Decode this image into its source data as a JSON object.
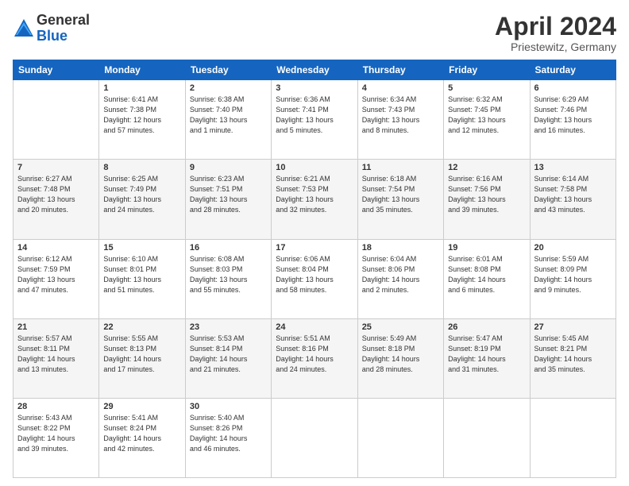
{
  "logo": {
    "general": "General",
    "blue": "Blue"
  },
  "title": "April 2024",
  "subtitle": "Priestewitz, Germany",
  "days_of_week": [
    "Sunday",
    "Monday",
    "Tuesday",
    "Wednesday",
    "Thursday",
    "Friday",
    "Saturday"
  ],
  "weeks": [
    [
      {
        "day": "",
        "info": ""
      },
      {
        "day": "1",
        "info": "Sunrise: 6:41 AM\nSunset: 7:38 PM\nDaylight: 12 hours\nand 57 minutes."
      },
      {
        "day": "2",
        "info": "Sunrise: 6:38 AM\nSunset: 7:40 PM\nDaylight: 13 hours\nand 1 minute."
      },
      {
        "day": "3",
        "info": "Sunrise: 6:36 AM\nSunset: 7:41 PM\nDaylight: 13 hours\nand 5 minutes."
      },
      {
        "day": "4",
        "info": "Sunrise: 6:34 AM\nSunset: 7:43 PM\nDaylight: 13 hours\nand 8 minutes."
      },
      {
        "day": "5",
        "info": "Sunrise: 6:32 AM\nSunset: 7:45 PM\nDaylight: 13 hours\nand 12 minutes."
      },
      {
        "day": "6",
        "info": "Sunrise: 6:29 AM\nSunset: 7:46 PM\nDaylight: 13 hours\nand 16 minutes."
      }
    ],
    [
      {
        "day": "7",
        "info": "Sunrise: 6:27 AM\nSunset: 7:48 PM\nDaylight: 13 hours\nand 20 minutes."
      },
      {
        "day": "8",
        "info": "Sunrise: 6:25 AM\nSunset: 7:49 PM\nDaylight: 13 hours\nand 24 minutes."
      },
      {
        "day": "9",
        "info": "Sunrise: 6:23 AM\nSunset: 7:51 PM\nDaylight: 13 hours\nand 28 minutes."
      },
      {
        "day": "10",
        "info": "Sunrise: 6:21 AM\nSunset: 7:53 PM\nDaylight: 13 hours\nand 32 minutes."
      },
      {
        "day": "11",
        "info": "Sunrise: 6:18 AM\nSunset: 7:54 PM\nDaylight: 13 hours\nand 35 minutes."
      },
      {
        "day": "12",
        "info": "Sunrise: 6:16 AM\nSunset: 7:56 PM\nDaylight: 13 hours\nand 39 minutes."
      },
      {
        "day": "13",
        "info": "Sunrise: 6:14 AM\nSunset: 7:58 PM\nDaylight: 13 hours\nand 43 minutes."
      }
    ],
    [
      {
        "day": "14",
        "info": "Sunrise: 6:12 AM\nSunset: 7:59 PM\nDaylight: 13 hours\nand 47 minutes."
      },
      {
        "day": "15",
        "info": "Sunrise: 6:10 AM\nSunset: 8:01 PM\nDaylight: 13 hours\nand 51 minutes."
      },
      {
        "day": "16",
        "info": "Sunrise: 6:08 AM\nSunset: 8:03 PM\nDaylight: 13 hours\nand 55 minutes."
      },
      {
        "day": "17",
        "info": "Sunrise: 6:06 AM\nSunset: 8:04 PM\nDaylight: 13 hours\nand 58 minutes."
      },
      {
        "day": "18",
        "info": "Sunrise: 6:04 AM\nSunset: 8:06 PM\nDaylight: 14 hours\nand 2 minutes."
      },
      {
        "day": "19",
        "info": "Sunrise: 6:01 AM\nSunset: 8:08 PM\nDaylight: 14 hours\nand 6 minutes."
      },
      {
        "day": "20",
        "info": "Sunrise: 5:59 AM\nSunset: 8:09 PM\nDaylight: 14 hours\nand 9 minutes."
      }
    ],
    [
      {
        "day": "21",
        "info": "Sunrise: 5:57 AM\nSunset: 8:11 PM\nDaylight: 14 hours\nand 13 minutes."
      },
      {
        "day": "22",
        "info": "Sunrise: 5:55 AM\nSunset: 8:13 PM\nDaylight: 14 hours\nand 17 minutes."
      },
      {
        "day": "23",
        "info": "Sunrise: 5:53 AM\nSunset: 8:14 PM\nDaylight: 14 hours\nand 21 minutes."
      },
      {
        "day": "24",
        "info": "Sunrise: 5:51 AM\nSunset: 8:16 PM\nDaylight: 14 hours\nand 24 minutes."
      },
      {
        "day": "25",
        "info": "Sunrise: 5:49 AM\nSunset: 8:18 PM\nDaylight: 14 hours\nand 28 minutes."
      },
      {
        "day": "26",
        "info": "Sunrise: 5:47 AM\nSunset: 8:19 PM\nDaylight: 14 hours\nand 31 minutes."
      },
      {
        "day": "27",
        "info": "Sunrise: 5:45 AM\nSunset: 8:21 PM\nDaylight: 14 hours\nand 35 minutes."
      }
    ],
    [
      {
        "day": "28",
        "info": "Sunrise: 5:43 AM\nSunset: 8:22 PM\nDaylight: 14 hours\nand 39 minutes."
      },
      {
        "day": "29",
        "info": "Sunrise: 5:41 AM\nSunset: 8:24 PM\nDaylight: 14 hours\nand 42 minutes."
      },
      {
        "day": "30",
        "info": "Sunrise: 5:40 AM\nSunset: 8:26 PM\nDaylight: 14 hours\nand 46 minutes."
      },
      {
        "day": "",
        "info": ""
      },
      {
        "day": "",
        "info": ""
      },
      {
        "day": "",
        "info": ""
      },
      {
        "day": "",
        "info": ""
      }
    ]
  ]
}
